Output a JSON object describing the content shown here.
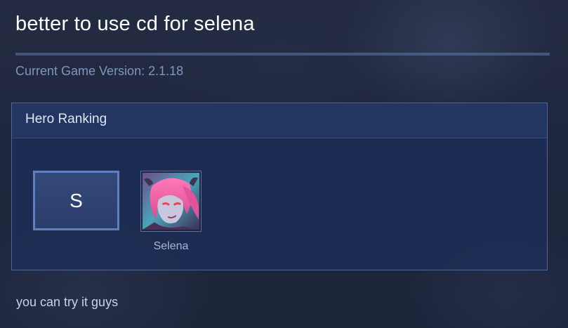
{
  "post": {
    "title": "better to use cd for selena",
    "game_version": "Current Game Version: 2.1.18",
    "footer_text": "you can try it guys"
  },
  "ranking": {
    "header": "Hero Ranking",
    "tier": "S",
    "heroes": [
      {
        "name": "Selena",
        "icon": "selena-portrait"
      }
    ]
  },
  "colors": {
    "accent_border": "#5f7fbe",
    "panel_bg": "#1e2e55",
    "version_text": "#7f97bd"
  }
}
